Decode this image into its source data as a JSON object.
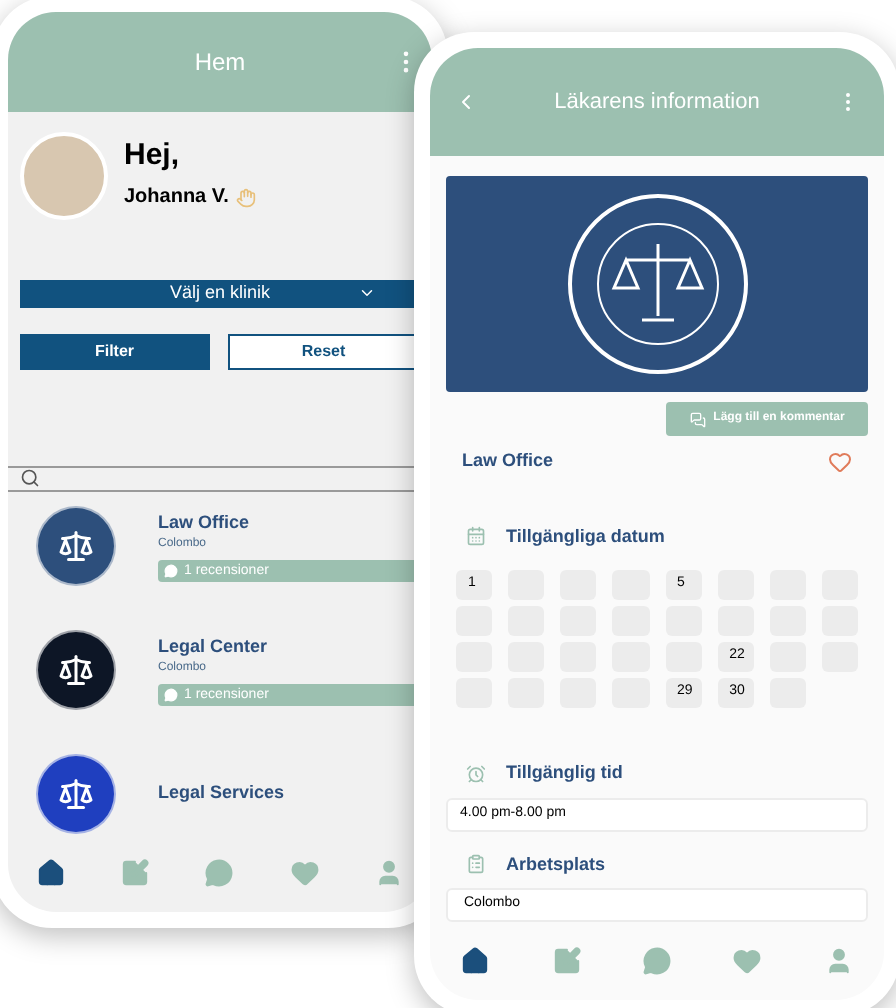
{
  "home_screen": {
    "header": {
      "title": "Hem"
    },
    "greeting": {
      "hello": "Hej,",
      "name": "Johanna V."
    },
    "clinic_select": {
      "value": "Välj en klinik"
    },
    "buttons": [
      {
        "label": "Filter",
        "kind": "primary"
      },
      {
        "label": "Reset",
        "kind": "outline"
      }
    ],
    "clinics": [
      {
        "name": "Law Office",
        "city": "Colombo",
        "reviews": "1 recensioner",
        "kind": "seal"
      },
      {
        "name": "Legal Center",
        "city": "Colombo",
        "reviews": "1 recensioner",
        "kind": "dark"
      },
      {
        "name": "Legal Services",
        "kind": "blue"
      }
    ],
    "nav": [
      {
        "kind": "home",
        "selected": true
      },
      {
        "kind": "edit",
        "selected": false
      },
      {
        "kind": "chat",
        "selected": false
      },
      {
        "kind": "heart",
        "selected": false
      },
      {
        "kind": "user",
        "selected": false
      }
    ]
  },
  "detail_screen": {
    "header": {
      "title": "Läkarens information"
    },
    "comment_button": "Lägg till en kommentar",
    "name": "Law Office",
    "favorite": false,
    "dates_title": "Tillgängliga datum",
    "dates": [
      {
        "kind": "day",
        "day": "1"
      },
      {
        "kind": "blank"
      },
      {
        "kind": "blank"
      },
      {
        "kind": "blank"
      },
      {
        "kind": "day",
        "day": "5"
      },
      {
        "kind": "blank"
      },
      {
        "kind": "blank"
      },
      {
        "kind": "blank"
      },
      {
        "kind": "blank"
      },
      {
        "kind": "blank"
      },
      {
        "kind": "blank"
      },
      {
        "kind": "blank"
      },
      {
        "kind": "blank"
      },
      {
        "kind": "blank"
      },
      {
        "kind": "blank"
      },
      {
        "kind": "blank"
      },
      {
        "kind": "blank"
      },
      {
        "kind": "blank"
      },
      {
        "kind": "blank"
      },
      {
        "kind": "blank"
      },
      {
        "kind": "blank"
      },
      {
        "kind": "day",
        "day": "22"
      },
      {
        "kind": "blank"
      },
      {
        "kind": "blank"
      },
      {
        "kind": "blank"
      },
      {
        "kind": "blank"
      },
      {
        "kind": "blank"
      },
      {
        "kind": "blank"
      },
      {
        "kind": "day",
        "day": "29"
      },
      {
        "kind": "day",
        "day": "30"
      },
      {
        "kind": "blank"
      }
    ],
    "time_title": "Tillgänglig tid",
    "time_value": "4.00 pm-8.00 pm",
    "workplace_title": "Arbetsplats",
    "workplace_value": "Colombo",
    "nav": [
      {
        "kind": "home",
        "selected": true
      },
      {
        "kind": "edit",
        "selected": false
      },
      {
        "kind": "chat",
        "selected": false
      },
      {
        "kind": "heart",
        "selected": false
      },
      {
        "kind": "user",
        "selected": false
      }
    ]
  }
}
